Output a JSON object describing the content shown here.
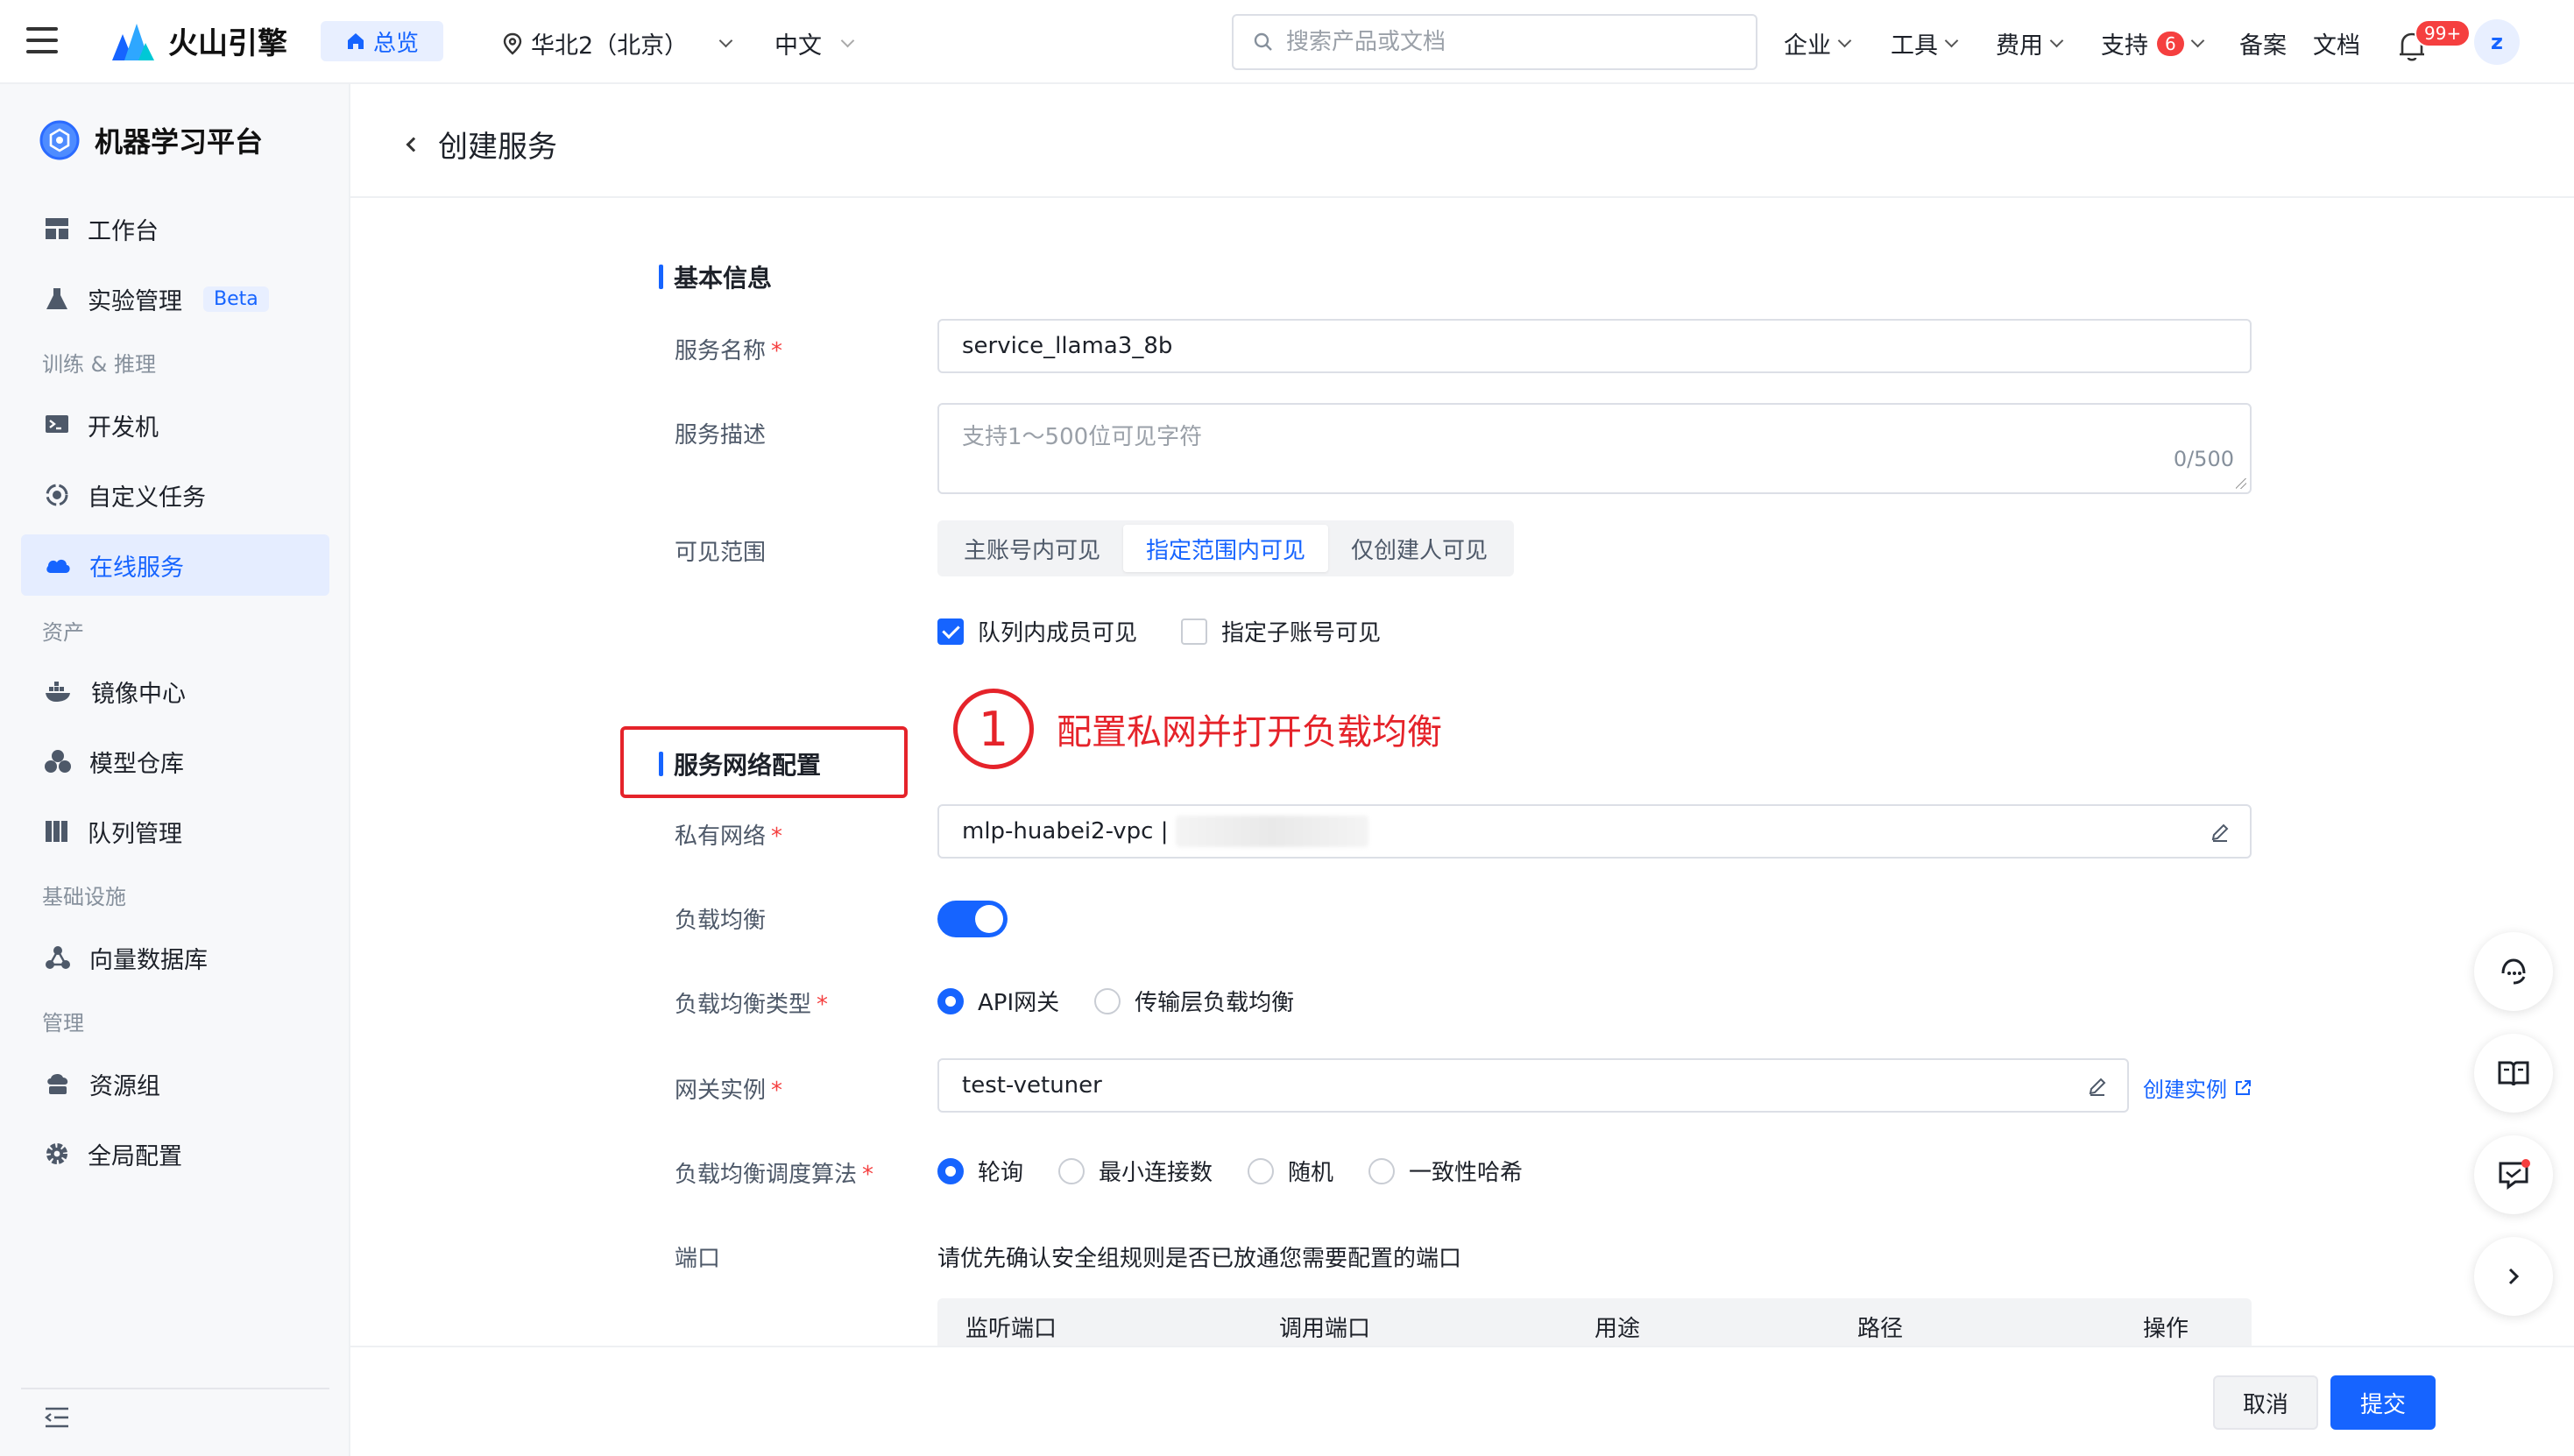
{
  "topbar": {
    "logo_text": "火山引擎",
    "overview_label": "总览",
    "region": "华北2（北京）",
    "language": "中文",
    "search_placeholder": "搜索产品或文档",
    "nav": {
      "enterprise": "企业",
      "tools": "工具",
      "billing": "费用",
      "support": "支持",
      "support_badge": "6",
      "filing": "备案",
      "docs": "文档"
    },
    "notification_badge": "99+",
    "avatar_initial": "z"
  },
  "sidebar": {
    "title": "机器学习平台",
    "items": {
      "workbench": "工作台",
      "experiments": "实验管理",
      "experiments_badge": "Beta",
      "section_train": "训练 & 推理",
      "devmachine": "开发机",
      "custom_tasks": "自定义任务",
      "online_service": "在线服务",
      "section_assets": "资产",
      "image_center": "镜像中心",
      "model_repo": "模型仓库",
      "queue_mgmt": "队列管理",
      "section_infra": "基础设施",
      "vector_db": "向量数据库",
      "section_admin": "管理",
      "resource_group": "资源组",
      "global_config": "全局配置"
    }
  },
  "page": {
    "title": "创建服务",
    "basic_section": "基本信息",
    "service_name_label": "服务名称",
    "service_name_value": "service_llama3_8b",
    "service_desc_label": "服务描述",
    "service_desc_placeholder": "支持1～500位可见字符",
    "service_desc_count": "0/500",
    "visibility_label": "可见范围",
    "visibility_options": [
      "主账号内可见",
      "指定范围内可见",
      "仅创建人可见"
    ],
    "visibility_selected": "指定范围内可见",
    "check_queue_members": "队列内成员可见",
    "check_sub_accounts": "指定子账号可见",
    "network_section": "服务网络配置",
    "annotation_number": "1",
    "annotation_text": "配置私网并打开负载均衡",
    "vpc_label": "私有网络",
    "vpc_value": "mlp-huabei2-vpc |",
    "lb_label": "负载均衡",
    "lb_type_label": "负载均衡类型",
    "lb_type_options": [
      "API网关",
      "传输层负载均衡"
    ],
    "gateway_label": "网关实例",
    "gateway_value": "test-vetuner",
    "create_instance_link": "创建实例",
    "algo_label": "负载均衡调度算法",
    "algo_options": [
      "轮询",
      "最小连接数",
      "随机",
      "一致性哈希"
    ],
    "port_label": "端口",
    "port_tip": "请优先确认安全组规则是否已放通您需要配置的端口",
    "port_table_headers": [
      "监听端口",
      "调用端口",
      "用途",
      "路径",
      "操作"
    ]
  },
  "footer": {
    "cancel": "取消",
    "submit": "提交"
  }
}
